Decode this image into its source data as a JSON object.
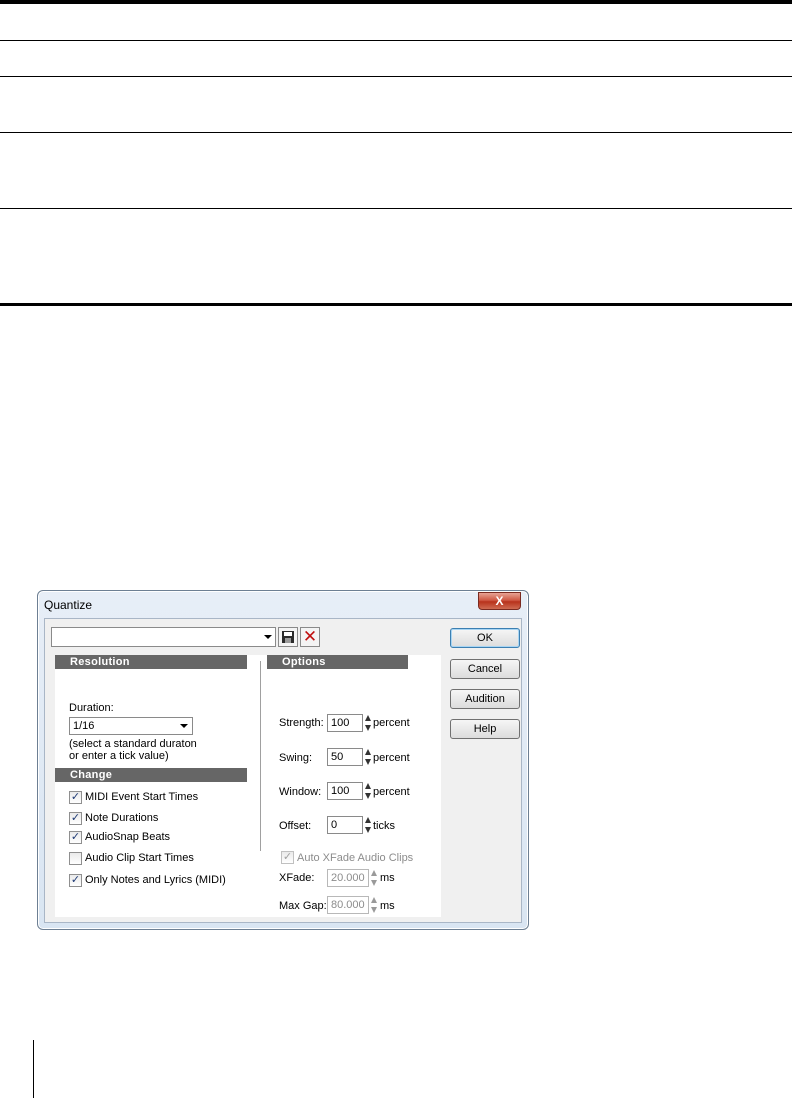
{
  "dialog": {
    "title": "Quantize",
    "close_glyph": "X",
    "preset": {
      "value": ""
    },
    "icons": {
      "save": "save-disk-icon",
      "delete": "delete-x-icon"
    },
    "buttons": {
      "ok": "OK",
      "cancel": "Cancel",
      "audition": "Audition",
      "help": "Help"
    },
    "resolution": {
      "header": "Resolution",
      "duration_label": "Duration:",
      "duration_value": "1/16",
      "hint_line1": "(select a standard duraton",
      "hint_line2": "or enter a tick value)"
    },
    "change": {
      "header": "Change",
      "items": [
        {
          "label": "MIDI Event Start Times",
          "checked": true
        },
        {
          "label": "Note Durations",
          "checked": true
        },
        {
          "label": "AudioSnap Beats",
          "checked": true
        },
        {
          "label": "Audio Clip Start Times",
          "checked": false
        },
        {
          "label": "Only Notes and Lyrics (MIDI)",
          "checked": true
        }
      ]
    },
    "options": {
      "header": "Options",
      "strength": {
        "label": "Strength:",
        "value": "100",
        "unit": "percent"
      },
      "swing": {
        "label": "Swing:",
        "value": "50",
        "unit": "percent"
      },
      "window": {
        "label": "Window:",
        "value": "100",
        "unit": "percent"
      },
      "offset": {
        "label": "Offset:",
        "value": "0",
        "unit": "ticks"
      },
      "auto_xfade": {
        "label": "Auto XFade Audio Clips",
        "checked": true,
        "disabled": true
      },
      "xfade": {
        "label": "XFade:",
        "value": "20.000",
        "unit": "ms"
      },
      "max_gap": {
        "label": "Max Gap:",
        "value": "80.000",
        "unit": "ms"
      }
    }
  }
}
